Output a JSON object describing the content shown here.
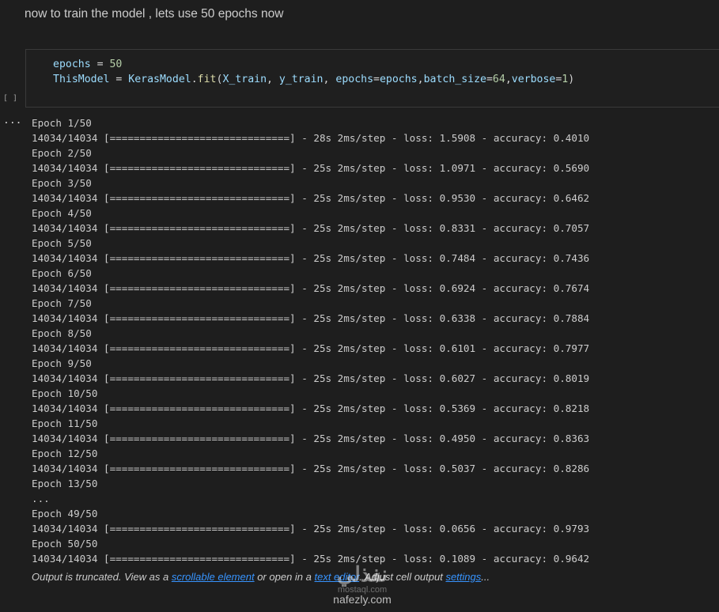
{
  "markdown": {
    "text": "now to train the model , lets use 50 epochs now"
  },
  "code": {
    "line1": {
      "var": "epochs",
      "eq": " = ",
      "val": "50"
    },
    "line2": {
      "var": "ThisModel",
      "eq": " = ",
      "cls": "KerasModel",
      "dot": ".",
      "fn": "fit",
      "open": "(",
      "a1": "X_train",
      "c1": ", ",
      "a2": "y_train",
      "c2": ", ",
      "k1": "epochs",
      "e1": "=",
      "v1": "epochs",
      "c3": ",",
      "k2": "batch_size",
      "e2": "=",
      "v2": "64",
      "c4": ",",
      "k3": "verbose",
      "e3": "=",
      "v3": "1",
      "close": ")"
    }
  },
  "cell": {
    "exec_count": "[ ]",
    "output_menu": "..."
  },
  "output_lines": [
    "Epoch 1/50",
    "14034/14034 [==============================] - 28s 2ms/step - loss: 1.5908 - accuracy: 0.4010",
    "Epoch 2/50",
    "14034/14034 [==============================] - 25s 2ms/step - loss: 1.0971 - accuracy: 0.5690",
    "Epoch 3/50",
    "14034/14034 [==============================] - 25s 2ms/step - loss: 0.9530 - accuracy: 0.6462",
    "Epoch 4/50",
    "14034/14034 [==============================] - 25s 2ms/step - loss: 0.8331 - accuracy: 0.7057",
    "Epoch 5/50",
    "14034/14034 [==============================] - 25s 2ms/step - loss: 0.7484 - accuracy: 0.7436",
    "Epoch 6/50",
    "14034/14034 [==============================] - 25s 2ms/step - loss: 0.6924 - accuracy: 0.7674",
    "Epoch 7/50",
    "14034/14034 [==============================] - 25s 2ms/step - loss: 0.6338 - accuracy: 0.7884",
    "Epoch 8/50",
    "14034/14034 [==============================] - 25s 2ms/step - loss: 0.6101 - accuracy: 0.7977",
    "Epoch 9/50",
    "14034/14034 [==============================] - 25s 2ms/step - loss: 0.6027 - accuracy: 0.8019",
    "Epoch 10/50",
    "14034/14034 [==============================] - 25s 2ms/step - loss: 0.5369 - accuracy: 0.8218",
    "Epoch 11/50",
    "14034/14034 [==============================] - 25s 2ms/step - loss: 0.4950 - accuracy: 0.8363",
    "Epoch 12/50",
    "14034/14034 [==============================] - 25s 2ms/step - loss: 0.5037 - accuracy: 0.8286",
    "Epoch 13/50",
    "...",
    "Epoch 49/50",
    "14034/14034 [==============================] - 25s 2ms/step - loss: 0.0656 - accuracy: 0.9793",
    "Epoch 50/50",
    "14034/14034 [==============================] - 25s 2ms/step - loss: 0.1089 - accuracy: 0.9642"
  ],
  "truncation": {
    "prefix": "Output is truncated. View as a ",
    "link1": "scrollable element",
    "middle": " or open in a ",
    "link2": "text editor",
    "middle2": ". Adjust cell output ",
    "link3": "settings",
    "suffix": "..."
  },
  "watermark": {
    "logo": "نفذلي",
    "sub": "mostaql.com",
    "name": "nafezly.com"
  },
  "colors": {
    "background": "#1e1e1e",
    "text": "#cccccc",
    "variable": "#9cdcfe",
    "function": "#dcdcaa",
    "number": "#b5cea8",
    "link": "#3794ff"
  }
}
